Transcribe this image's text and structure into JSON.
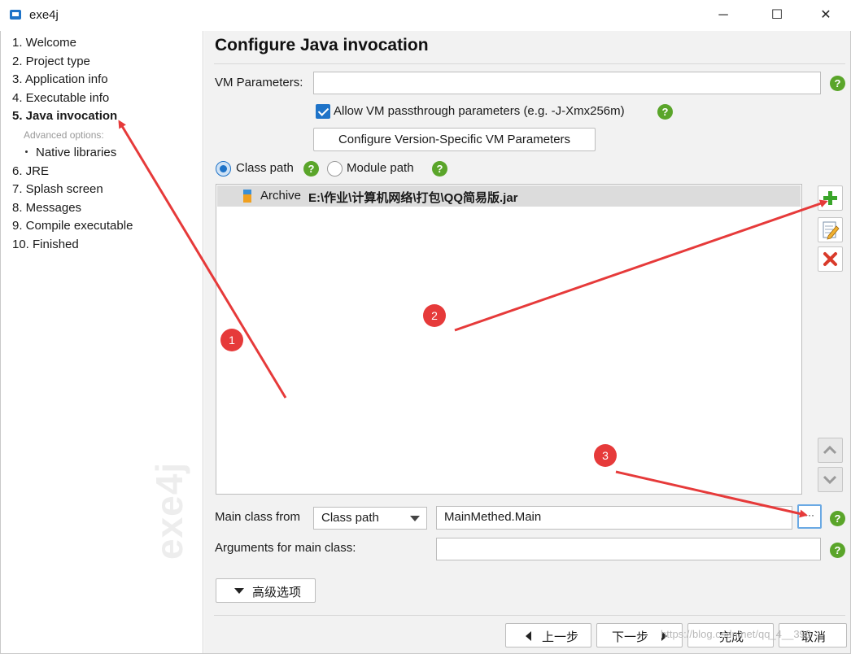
{
  "window": {
    "title": "exe4j",
    "minimize_glyph": "─",
    "maximize_glyph": "☐",
    "close_glyph": "✕"
  },
  "sidebar": {
    "steps": [
      {
        "label": "1. Welcome"
      },
      {
        "label": "2. Project type"
      },
      {
        "label": "3. Application info"
      },
      {
        "label": "4. Executable info"
      },
      {
        "label": "5. Java invocation",
        "active": true
      },
      {
        "label": "Advanced options:",
        "kind": "group-label"
      },
      {
        "label": "Native libraries",
        "kind": "sub-item"
      },
      {
        "label": "6. JRE"
      },
      {
        "label": "7. Splash screen"
      },
      {
        "label": "8. Messages"
      },
      {
        "label": "9. Compile executable"
      },
      {
        "label": "10. Finished"
      }
    ],
    "watermark": "exe4j"
  },
  "main": {
    "title": "Configure Java invocation",
    "vm_parameters": {
      "label": "VM Parameters:",
      "value": ""
    },
    "passthrough": {
      "label": "Allow VM passthrough parameters (e.g. -J-Xmx256m)",
      "checked": true
    },
    "version_specific_button": "Configure Version-Specific VM Parameters",
    "path_mode": {
      "class_path_label": "Class path",
      "module_path_label": "Module path",
      "selected": "Class path"
    },
    "classpath_entries": [
      {
        "kind": "Archive",
        "path": "E:\\作业\\计算机网络\\打包\\QQ简易版.jar"
      }
    ],
    "side_buttons": {
      "add": "add-icon",
      "edit": "edit-icon",
      "remove": "remove-icon",
      "up": "move-up-icon",
      "down": "move-down-icon"
    },
    "main_class": {
      "label": "Main class from",
      "source": "Class path",
      "value": "MainMethed.Main",
      "browse_label": "···"
    },
    "arguments": {
      "label": "Arguments for main class:",
      "value": ""
    },
    "advanced_button": "高级选项",
    "help_glyph": "?",
    "nav": {
      "back": "上一步",
      "next": "下一步",
      "finish": "完成",
      "cancel": "取消"
    }
  },
  "annotations": {
    "markers": [
      "1",
      "2",
      "3"
    ],
    "color": "#e63a3a"
  },
  "csdn_watermark": "https://blog.csdn.net/qq_4__393",
  "colors": {
    "accent": "#1e73c8",
    "help": "#5aa52a",
    "add": "#3aa52a",
    "remove": "#d93b2b",
    "annotation": "#e63a3a"
  }
}
